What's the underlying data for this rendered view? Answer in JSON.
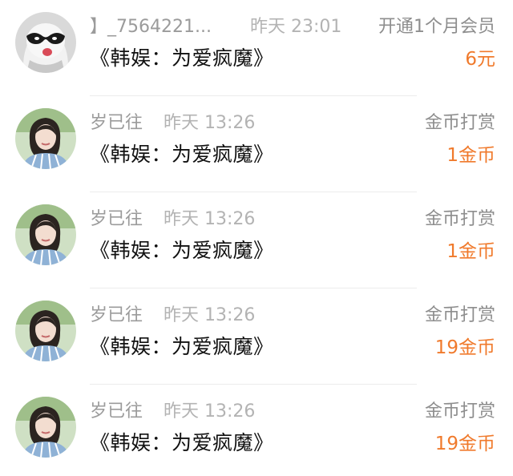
{
  "rows": [
    {
      "avatar": "ghost-mask-avatar",
      "user": "】_7564221...",
      "time": "昨天 23:01",
      "type": "开通1个月会员",
      "book": "《韩娱：为爱疯魔》",
      "amount": "6元"
    },
    {
      "avatar": "girl-portrait-avatar",
      "user": "岁已往",
      "time": "昨天 13:26",
      "type": "金币打赏",
      "book": "《韩娱：为爱疯魔》",
      "amount": "1金币"
    },
    {
      "avatar": "girl-portrait-avatar",
      "user": "岁已往",
      "time": "昨天 13:26",
      "type": "金币打赏",
      "book": "《韩娱：为爱疯魔》",
      "amount": "1金币"
    },
    {
      "avatar": "girl-portrait-avatar",
      "user": "岁已往",
      "time": "昨天 13:26",
      "type": "金币打赏",
      "book": "《韩娱：为爱疯魔》",
      "amount": "19金币"
    },
    {
      "avatar": "girl-portrait-avatar",
      "user": "岁已往",
      "time": "昨天 13:26",
      "type": "金币打赏",
      "book": "《韩娱：为爱疯魔》",
      "amount": "19金币"
    }
  ],
  "colors": {
    "amount": "#f07a2c",
    "meta": "#9b9b9b",
    "title": "#111111"
  }
}
